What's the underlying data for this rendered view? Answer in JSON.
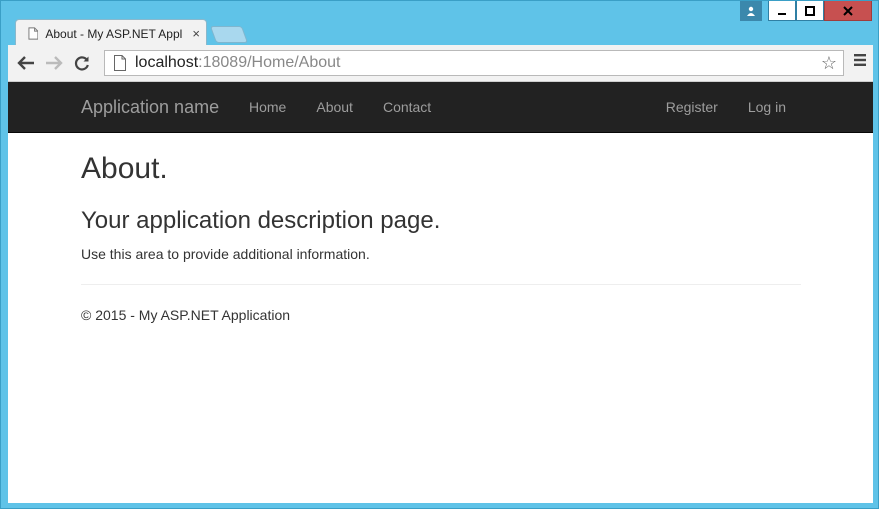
{
  "window": {
    "tab_title": "About - My ASP.NET Appl",
    "tab_close": "×"
  },
  "toolbar": {
    "url_host": "localhost",
    "url_rest": ":18089/Home/About"
  },
  "navbar": {
    "brand": "Application name",
    "links": [
      "Home",
      "About",
      "Contact"
    ],
    "right_links": [
      "Register",
      "Log in"
    ]
  },
  "page": {
    "heading": "About.",
    "subheading": "Your application description page.",
    "body_text": "Use this area to provide additional information.",
    "footer": "© 2015 - My ASP.NET Application"
  },
  "colors": {
    "frame": "#5fc3e8",
    "navbar_bg": "#222222",
    "navbar_text": "#9d9d9d",
    "close_button": "#c75050"
  }
}
